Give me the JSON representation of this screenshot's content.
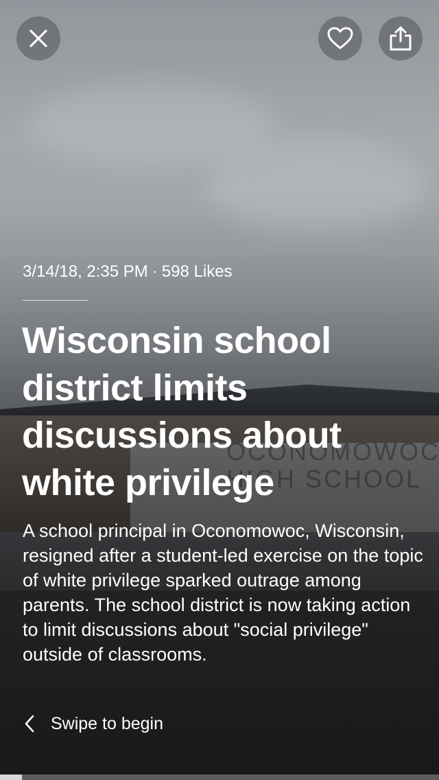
{
  "story": {
    "date": "3/14/18, 2:35 PM",
    "separator": "·",
    "likes": "598 Likes",
    "headline": "Wisconsin school district limits discussions about white privilege",
    "summary": "A school principal in Oconomowoc, Wisconsin, resigned after a student-led exercise on the topic of white privilege sparked outrage among parents. The school district is now taking action to limit discussions about \"social privilege\" outside of classrooms.",
    "background_sign": "OCONOMOWOC\nHIGH SCHOOL"
  },
  "controls": {
    "close_icon": "close-icon",
    "like_icon": "heart-icon",
    "share_icon": "share-icon",
    "swipe_label": "Swipe to begin",
    "swipe_icon": "chevron-left-icon"
  },
  "progress": {
    "fraction": 0.05
  },
  "colors": {
    "text": "#ffffff",
    "button_bg": "rgba(90,92,96,0.62)"
  }
}
